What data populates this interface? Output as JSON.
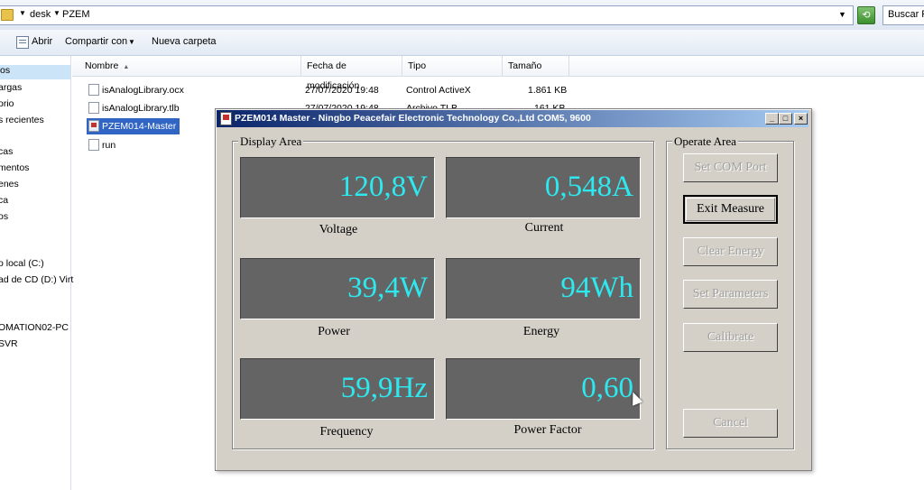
{
  "explorer": {
    "breadcrumb": [
      "desk",
      "PZEM"
    ],
    "search_placeholder": "Buscar PZ",
    "toolbar": {
      "open_label": "Abrir",
      "share_label": "Compartir con",
      "new_folder_label": "Nueva carpeta"
    },
    "nav_items": [
      "os",
      "argas",
      "orio",
      "s recientes",
      "cas",
      "mentos",
      "enes",
      "ca",
      "os",
      "o local (C:)",
      "ad de CD (D:) Virt",
      "OMATION02-PC",
      "SVR"
    ],
    "columns": [
      "Nombre",
      "Fecha de modificación",
      "Tipo",
      "Tamaño"
    ],
    "files": [
      {
        "name": "isAnalogLibrary.ocx",
        "date": "27/07/2020 19:48",
        "type": "Control ActiveX",
        "size": "1.861 KB"
      },
      {
        "name": "isAnalogLibrary.tlb",
        "date": "27/07/2020 19:48",
        "type": "Archivo TLB",
        "size": "161 KB"
      },
      {
        "name": "PZEM014-Master",
        "date": "",
        "type": "",
        "size": ""
      },
      {
        "name": "run",
        "date": "",
        "type": "",
        "size": ""
      }
    ]
  },
  "dialog": {
    "title": "PZEM014 Master - Ningbo Peacefair Electronic Technology Co.,Ltd  COM5, 9600",
    "display_area_label": "Display Area",
    "operate_area_label": "Operate Area",
    "readings": {
      "voltage": {
        "value": "120,8V",
        "label": "Voltage"
      },
      "current": {
        "value": "0,548A",
        "label": "Current"
      },
      "power": {
        "value": "39,4W",
        "label": "Power"
      },
      "energy": {
        "value": "94Wh",
        "label": "Energy"
      },
      "frequency": {
        "value": "59,9Hz",
        "label": "Frequency"
      },
      "power_factor": {
        "value": "0,60",
        "label": "Power Factor"
      }
    },
    "buttons": {
      "set_com_port": "Set COM Port",
      "exit_measure": "Exit Measure",
      "clear_energy": "Clear Energy",
      "set_parameters": "Set Parameters",
      "calibrate": "Calibrate",
      "cancel": "Cancel"
    },
    "display_color": "#2ee8f0"
  }
}
